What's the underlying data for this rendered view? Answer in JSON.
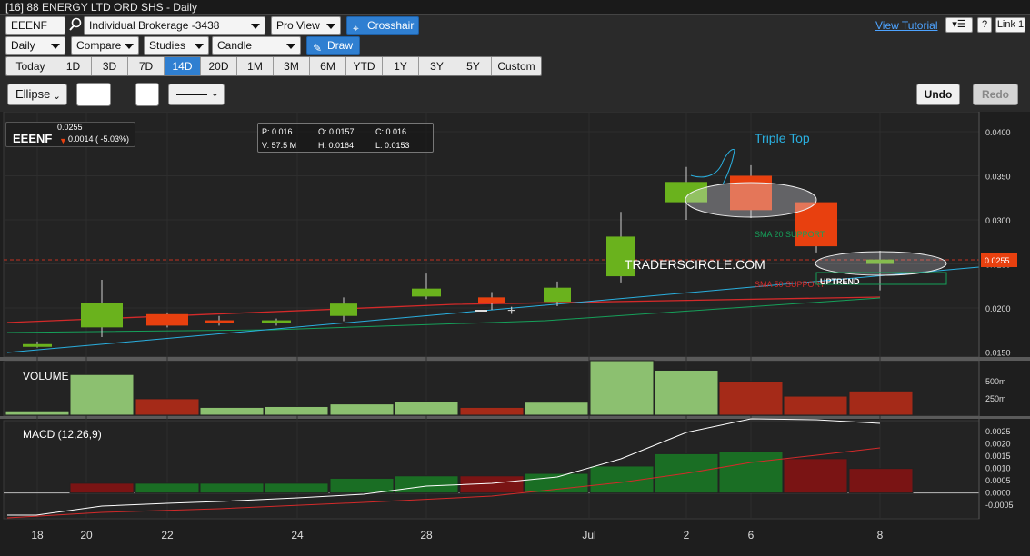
{
  "window": {
    "title": "[16] 88 ENERGY LTD ORD SHS - Daily"
  },
  "toolbar1": {
    "symbol": "EEENF",
    "account": "Individual Brokerage -3438",
    "view": "Pro View",
    "crosshair": "Crosshair",
    "tutorial": "View Tutorial",
    "help": "?",
    "link": "Link 1"
  },
  "toolbar2": {
    "interval": "Daily",
    "compare": "Compare",
    "studies": "Studies",
    "chart_type": "Candle",
    "draw": "Draw"
  },
  "ranges": [
    "Today",
    "1D",
    "3D",
    "7D",
    "14D",
    "20D",
    "1M",
    "3M",
    "6M",
    "YTD",
    "1Y",
    "3Y",
    "5Y",
    "Custom"
  ],
  "active_range": "14D",
  "drawing": {
    "shape": "Ellipse",
    "undo": "Undo",
    "redo": "Redo"
  },
  "quote": {
    "symbol": "EEENF",
    "price": "0.0255",
    "change": "0.0014 ( -5.03%)"
  },
  "ohlc": {
    "p": "P: 0.016",
    "o": "O: 0.0157",
    "c": "C: 0.016",
    "v": "V: 57.5 M",
    "h": "H: 0.0164",
    "l": "L: 0.0153"
  },
  "colors": {
    "up": "#6ab21d",
    "down": "#e8400f",
    "sma20": "#16a05a",
    "sma50": "#d42a2a",
    "trend": "#2ab0e0",
    "annotation": "#2ab0e0"
  },
  "chart_data": [
    {
      "type": "candlestick",
      "title": "",
      "x_ticks": [
        "18",
        "20",
        "22",
        "24",
        "28",
        "Jul",
        "2",
        "6",
        "8"
      ],
      "y_ticks": [
        "0.0400",
        "0.0350",
        "0.0300",
        "0.0250",
        "0.0200",
        "0.0150"
      ],
      "ylim": [
        0.014,
        0.041
      ],
      "last_price_label": "0.0255",
      "candles": [
        {
          "o": 0.0159,
          "h": 0.0162,
          "l": 0.0155,
          "c": 0.0157,
          "dir": "up"
        },
        {
          "o": 0.0178,
          "h": 0.0232,
          "l": 0.0167,
          "c": 0.0206,
          "dir": "up"
        },
        {
          "o": 0.0193,
          "h": 0.0195,
          "l": 0.0178,
          "c": 0.018,
          "dir": "down"
        },
        {
          "o": 0.0186,
          "h": 0.0191,
          "l": 0.018,
          "c": 0.0183,
          "dir": "down"
        },
        {
          "o": 0.0183,
          "h": 0.0188,
          "l": 0.018,
          "c": 0.0186,
          "dir": "up"
        },
        {
          "o": 0.0191,
          "h": 0.0212,
          "l": 0.0185,
          "c": 0.0205,
          "dir": "up"
        },
        {
          "o": 0.0213,
          "h": 0.0239,
          "l": 0.021,
          "c": 0.0222,
          "dir": "up"
        },
        {
          "o": 0.0212,
          "h": 0.0218,
          "l": 0.0198,
          "c": 0.0206,
          "dir": "down"
        },
        {
          "o": 0.0207,
          "h": 0.023,
          "l": 0.0202,
          "c": 0.0223,
          "dir": "up"
        },
        {
          "o": 0.0236,
          "h": 0.0309,
          "l": 0.0229,
          "c": 0.0281,
          "dir": "up"
        },
        {
          "o": 0.032,
          "h": 0.036,
          "l": 0.03,
          "c": 0.0343,
          "dir": "up"
        },
        {
          "o": 0.035,
          "h": 0.0362,
          "l": 0.0302,
          "c": 0.0311,
          "dir": "down"
        },
        {
          "o": 0.032,
          "h": 0.032,
          "l": 0.0263,
          "c": 0.027,
          "dir": "down"
        },
        {
          "o": 0.0255,
          "h": 0.0265,
          "l": 0.022,
          "c": 0.025,
          "dir": "up"
        }
      ],
      "annotations": [
        "Triple Top",
        "SMA 20 SUPPORT",
        "SMA 50 SUPPORT",
        "UPTREND",
        "TRADERSCIRCLE.COM"
      ]
    },
    {
      "type": "bar",
      "title": "VOLUME",
      "y_ticks": [
        "500m",
        "250m"
      ],
      "values": [
        5,
        47,
        19,
        9,
        10,
        13,
        16,
        9,
        15,
        63,
        52,
        39,
        22,
        28
      ],
      "colors": [
        "up",
        "up",
        "down",
        "up",
        "up",
        "up",
        "up",
        "down",
        "up",
        "up",
        "up",
        "down",
        "down",
        "down"
      ]
    },
    {
      "type": "line",
      "title": "MACD (12,26,9)",
      "y_ticks": [
        "0.0025",
        "0.0020",
        "0.0015",
        "0.0010",
        "0.0005",
        "0.0000",
        "-0.0005"
      ],
      "ylim": [
        -0.0009,
        0.0028
      ],
      "histogram": [
        0.0004,
        0.0004,
        0.0004,
        0.0004,
        0.0004,
        0.0006,
        0.0007,
        0.0007,
        0.0008,
        0.0011,
        0.0016,
        0.0017,
        0.0014,
        0.001
      ],
      "hist_colors": [
        "up",
        "down",
        "up",
        "up",
        "up",
        "up",
        "up",
        "down",
        "up",
        "up",
        "up",
        "up",
        "down",
        "down"
      ]
    }
  ]
}
